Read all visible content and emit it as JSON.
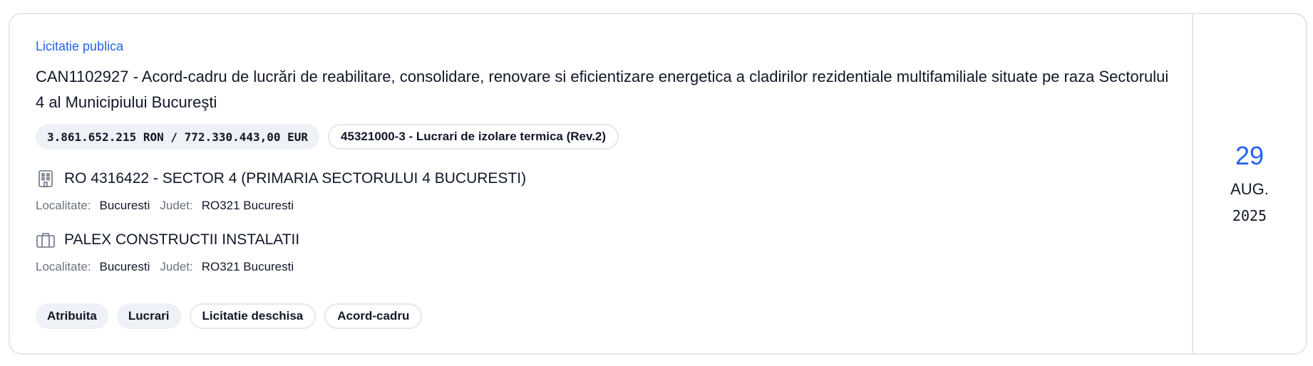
{
  "procedure_type": "Licitatie publica",
  "title": "CAN1102927 - Acord-cadru de lucrări de reabilitare, consolidare, renovare si eficientizare energetica a cladirilor rezidentiale multifamiliale situate pe raza Sectorului 4 al Municipiului Bucureşti",
  "value_chip": "3.861.652.215 RON / 772.330.443,00 EUR",
  "cpv_chip": "45321000-3 - Lucrari de izolare termica (Rev.2)",
  "authority": {
    "icon": "building-icon",
    "name": "RO 4316422 - SECTOR 4 (PRIMARIA SECTORULUI 4 BUCURESTI)",
    "localitate_label": "Localitate:",
    "localitate": "Bucuresti",
    "judet_label": "Judet:",
    "judet": "RO321 Bucuresti"
  },
  "supplier": {
    "icon": "briefcase-icon",
    "name": "PALEX CONSTRUCTII INSTALATII",
    "localitate_label": "Localitate:",
    "localitate": "Bucuresti",
    "judet_label": "Judet:",
    "judet": "RO321 Bucuresti"
  },
  "tags": [
    "Atribuita",
    "Lucrari",
    "Licitatie deschisa",
    "Acord-cadru"
  ],
  "date": {
    "day": "29",
    "month": "AUG.",
    "year": "2025"
  },
  "colors": {
    "accent": "#2563eb",
    "chip_bg": "#eef1f6",
    "border": "#e5e7eb",
    "muted": "#6b7280"
  }
}
